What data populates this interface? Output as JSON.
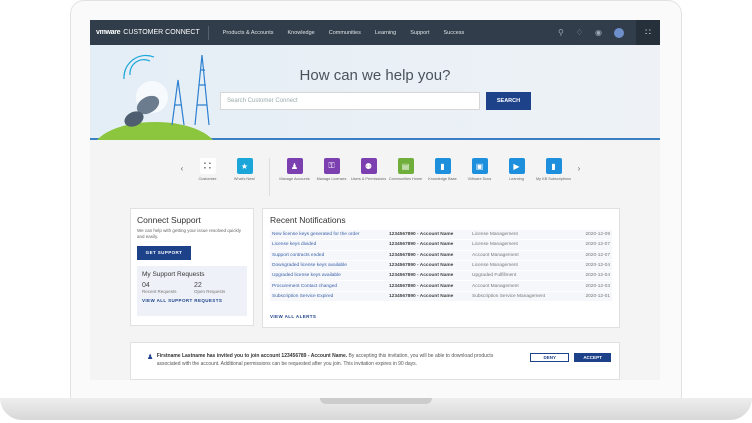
{
  "nav": {
    "logo_mark": "vmware",
    "logo_text": "CUSTOMER CONNECT",
    "items": [
      "Products & Accounts",
      "Knowledge",
      "Communities",
      "Learning",
      "Support",
      "Success"
    ]
  },
  "hero": {
    "title": "How can we help you?",
    "search_placeholder": "Search Customer Connect",
    "search_button": "SEARCH"
  },
  "shortcuts": [
    {
      "label": "Customize",
      "color": "#ffffff",
      "icon": "grid-icon"
    },
    {
      "label": "What's New!",
      "color": "#1ba6d9",
      "icon": "star-icon"
    },
    {
      "label": "Manage Accounts",
      "color": "#7b3fb0",
      "icon": "account-icon"
    },
    {
      "label": "Manage Licenses",
      "color": "#7b3fb0",
      "icon": "key-icon"
    },
    {
      "label": "Users & Permissions",
      "color": "#7b3fb0",
      "icon": "users-icon"
    },
    {
      "label": "Communities Home",
      "color": "#6fae3a",
      "icon": "chat-icon"
    },
    {
      "label": "Knowledge Base",
      "color": "#1e8fdc",
      "icon": "document-icon"
    },
    {
      "label": "VMware Docs",
      "color": "#1e8fdc",
      "icon": "docs-icon"
    },
    {
      "label": "Learning",
      "color": "#1e8fdc",
      "icon": "video-icon"
    },
    {
      "label": "My KB Subscriptions",
      "color": "#1e8fdc",
      "icon": "document-icon"
    }
  ],
  "support": {
    "title": "Connect Support",
    "desc": "We can help with getting your issue resolved quickly and easily.",
    "button": "GET SUPPORT",
    "requests_title": "My Support Requests",
    "recent_count": "04",
    "recent_label": "Recent Requests",
    "open_count": "22",
    "open_label": "Open Requests",
    "view_all": "VIEW ALL SUPPORT REQUESTS"
  },
  "notifications": {
    "title": "Recent Notifications",
    "view_all": "VIEW ALL ALERTS",
    "rows": [
      {
        "title": "New license keys generated for the order",
        "account": "1234567890 - Account Name",
        "category": "License Management",
        "date": "2020-12-09"
      },
      {
        "title": "License keys divided",
        "account": "1234567890 - Account Name",
        "category": "License Management",
        "date": "2020-12-07"
      },
      {
        "title": "Support contracts ended",
        "account": "1234567890 - Account Name",
        "category": "Account Management",
        "date": "2020-12-07"
      },
      {
        "title": "Downgraded license keys available",
        "account": "1234567890 - Account Name",
        "category": "License Management",
        "date": "2020-12-04"
      },
      {
        "title": "Upgraded license keys available",
        "account": "1234567890 - Account Name",
        "category": "Upgraded Fulfillment",
        "date": "2020-12-04"
      },
      {
        "title": "Procurement Contact changed",
        "account": "1234567890 - Account Name",
        "category": "Account Management",
        "date": "2020-12-03"
      },
      {
        "title": "Subscription Service Expired",
        "account": "1234567890 - Account Name",
        "category": "Subscription Service Management",
        "date": "2020-12-01"
      }
    ]
  },
  "invitation": {
    "bold": "Firstname Lastname has invited you to join account 123456789 - Account Name.",
    "text": " By accepting this invitation, you will be able to download products associated with the account. Additional permissions can be requested after you join. This invitation expires in 90 days.",
    "deny": "DENY",
    "accept": "ACCEPT"
  }
}
